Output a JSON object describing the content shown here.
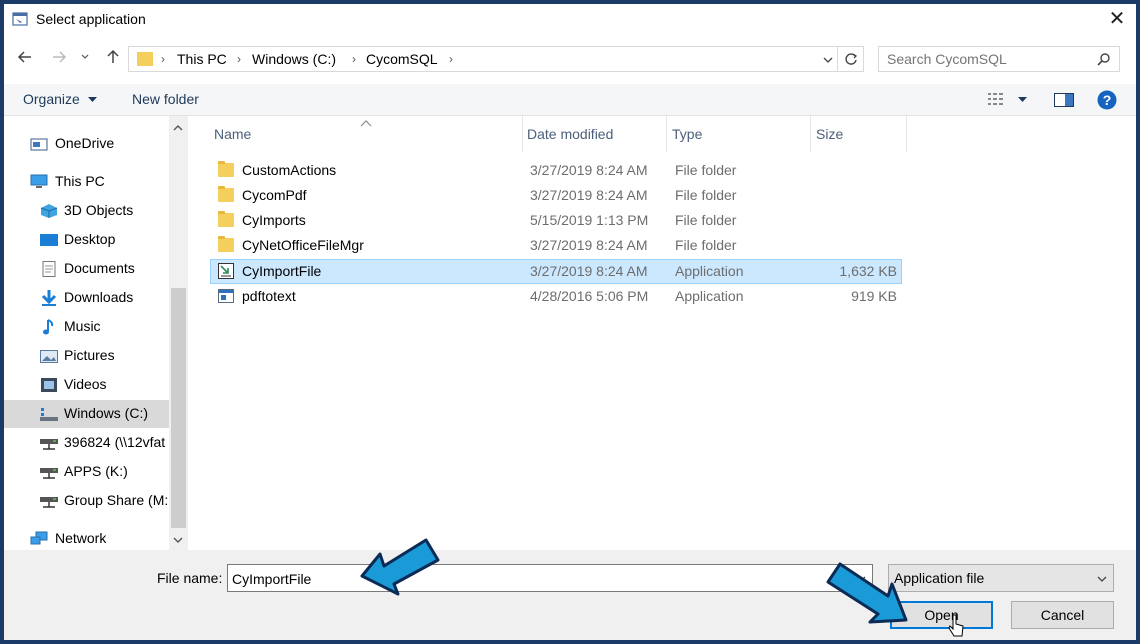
{
  "window": {
    "title": "Select application",
    "close_glyph": "✕"
  },
  "address": {
    "crumbs": [
      "This PC",
      "Windows (C:)",
      "CycomSQL"
    ],
    "sep": "›"
  },
  "search": {
    "placeholder": "Search CycomSQL"
  },
  "toolbar": {
    "organize": "Organize",
    "new_folder": "New folder"
  },
  "nav": {
    "items": [
      {
        "label": "OneDrive",
        "icon": "onedrive-icon"
      },
      {
        "label": "This PC",
        "icon": "computer-icon"
      },
      {
        "label": "3D Objects",
        "icon": "3d-objects-icon"
      },
      {
        "label": "Desktop",
        "icon": "desktop-icon"
      },
      {
        "label": "Documents",
        "icon": "documents-icon"
      },
      {
        "label": "Downloads",
        "icon": "downloads-icon"
      },
      {
        "label": "Music",
        "icon": "music-icon"
      },
      {
        "label": "Pictures",
        "icon": "pictures-icon"
      },
      {
        "label": "Videos",
        "icon": "videos-icon"
      },
      {
        "label": "Windows (C:)",
        "icon": "drive-icon"
      },
      {
        "label": "396824 (\\\\12vfat",
        "icon": "network-drive-icon"
      },
      {
        "label": "APPS (K:)",
        "icon": "network-drive-icon"
      },
      {
        "label": "Group Share (M:",
        "icon": "network-drive-icon"
      },
      {
        "label": "Network",
        "icon": "network-icon"
      }
    ]
  },
  "columns": {
    "name": "Name",
    "date": "Date modified",
    "type": "Type",
    "size": "Size"
  },
  "files": [
    {
      "name": "CustomActions",
      "date": "3/27/2019 8:24 AM",
      "type": "File folder",
      "size": "",
      "kind": "folder"
    },
    {
      "name": "CycomPdf",
      "date": "3/27/2019 8:24 AM",
      "type": "File folder",
      "size": "",
      "kind": "folder"
    },
    {
      "name": "CyImports",
      "date": "5/15/2019 1:13 PM",
      "type": "File folder",
      "size": "",
      "kind": "folder"
    },
    {
      "name": "CyNetOfficeFileMgr",
      "date": "3/27/2019 8:24 AM",
      "type": "File folder",
      "size": "",
      "kind": "folder"
    },
    {
      "name": "CyImportFile",
      "date": "3/27/2019 8:24 AM",
      "type": "Application",
      "size": "1,632 KB",
      "kind": "app"
    },
    {
      "name": "pdftotext",
      "date": "4/28/2016 5:06 PM",
      "type": "Application",
      "size": "919 KB",
      "kind": "app2"
    }
  ],
  "bottom": {
    "file_name_label": "File name:",
    "file_name_value": "CyImportFile",
    "filter_value": "Application file",
    "open_label": "Open",
    "cancel_label": "Cancel"
  },
  "colors": {
    "accent": "#0078d7",
    "selection": "#cce8ff",
    "arrow": "#1a9ad6",
    "frame": "#1b3a66"
  }
}
